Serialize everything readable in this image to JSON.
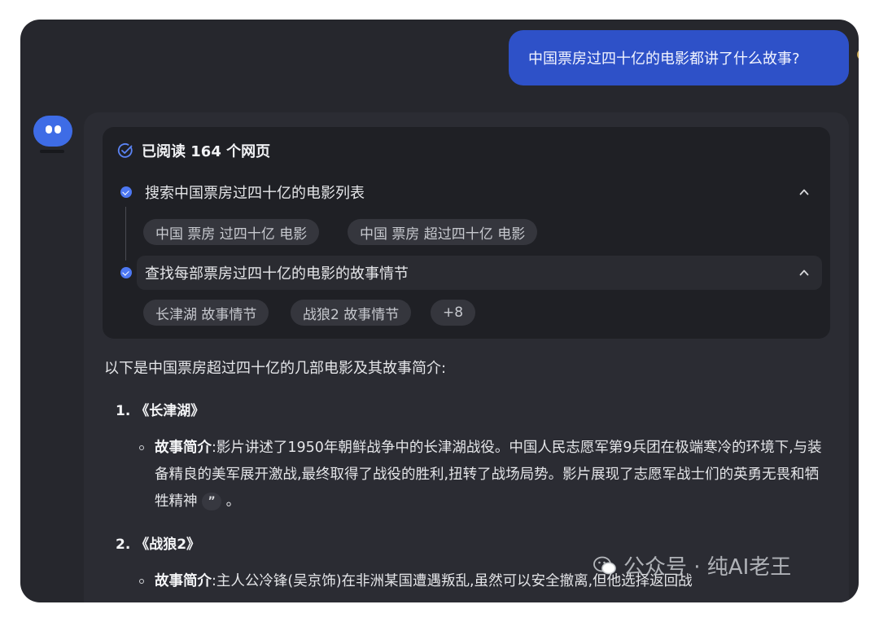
{
  "user_message": "中国票房过四十亿的电影都讲了什么故事?",
  "search_summary": {
    "read_label": "已阅读 164 个网页",
    "steps": [
      {
        "label": "搜索中国票房过四十亿的电影列表",
        "chips": [
          "中国 票房 过四十亿 电影",
          "中国 票房 超过四十亿 电影"
        ]
      },
      {
        "label": "查找每部票房过四十亿的电影的故事情节",
        "chips": [
          "长津湖 故事情节",
          "战狼2 故事情节",
          "+8"
        ]
      }
    ]
  },
  "answer": {
    "intro": "以下是中国票房超过四十亿的几部电影及其故事简介:",
    "items": [
      {
        "number": "1.",
        "title": "《长津湖》",
        "summary_label": "故事简介",
        "summary_text": ":影片讲述了1950年朝鲜战争中的长津湖战役。中国人民志愿军第9兵团在极端寒冷的环境下,与装备精良的美军展开激战,最终取得了战役的胜利,扭转了战场局势。影片展现了志愿军战士们的英勇无畏和牺牲精神",
        "quote_mark": "”",
        "end": "。"
      },
      {
        "number": "2.",
        "title": "《战狼2》",
        "summary_label": "故事简介",
        "summary_text": ":主人公冷锋(吴京饰)在非洲某国遭遇叛乱,虽然可以安全撤离,但他选择返回战"
      }
    ]
  },
  "watermark": "公众号 · 纯AI老王",
  "colors": {
    "accent": "#2e51c8",
    "panel": "#2b2c33",
    "card": "#1f2025",
    "window": "#26272d"
  },
  "icons": [
    "check-circle-icon",
    "chevron-up-icon",
    "step-check-icon",
    "quote-icon",
    "wechat-icon",
    "bot-avatar"
  ]
}
